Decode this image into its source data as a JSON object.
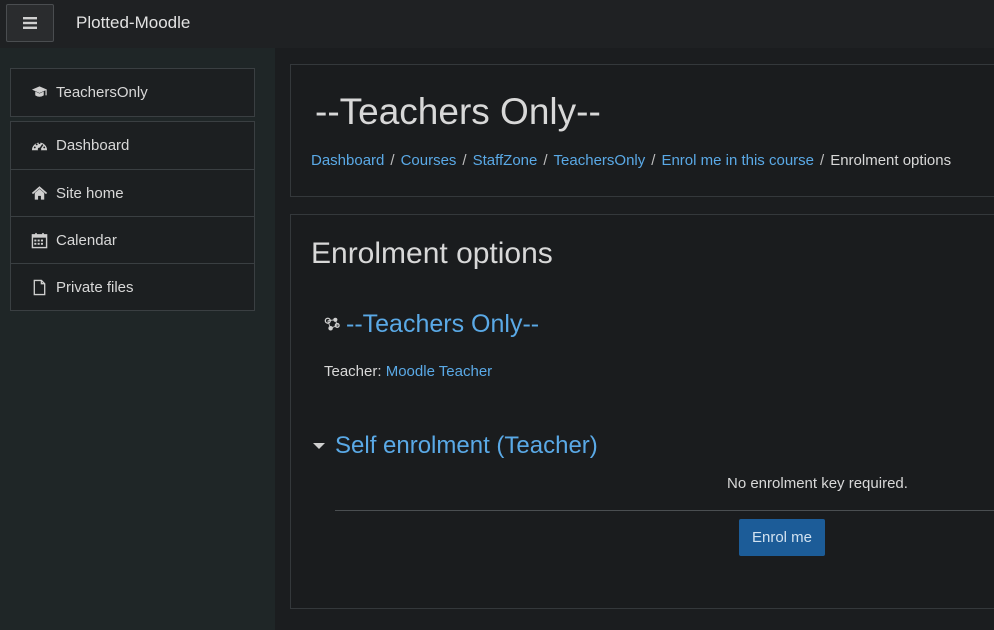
{
  "navbar": {
    "site_name": "Plotted-Moodle"
  },
  "drawer": {
    "course_item": {
      "label": "TeachersOnly",
      "icon": "graduation-cap-icon"
    },
    "items": [
      {
        "label": "Dashboard",
        "icon": "dashboard-icon"
      },
      {
        "label": "Site home",
        "icon": "home-icon"
      },
      {
        "label": "Calendar",
        "icon": "calendar-icon"
      },
      {
        "label": "Private files",
        "icon": "file-icon"
      }
    ]
  },
  "header": {
    "title": "--Teachers Only--",
    "breadcrumb": [
      {
        "label": "Dashboard"
      },
      {
        "label": "Courses"
      },
      {
        "label": "StaffZone"
      },
      {
        "label": "TeachersOnly"
      },
      {
        "label": "Enrol me in this course"
      },
      {
        "label": "Enrolment options"
      }
    ],
    "separator": "/"
  },
  "main": {
    "heading": "Enrolment options",
    "course_name": "--Teachers Only--",
    "teacher_label": "Teacher:",
    "teacher_name": "Moodle Teacher",
    "enrol_method_heading": "Self enrolment (Teacher)",
    "no_key_text": "No enrolment key required.",
    "enrol_button_label": "Enrol me"
  },
  "colors": {
    "link": "#5aa9e6",
    "primary_button": "#1c5c98",
    "background": "#1b1d1f"
  }
}
